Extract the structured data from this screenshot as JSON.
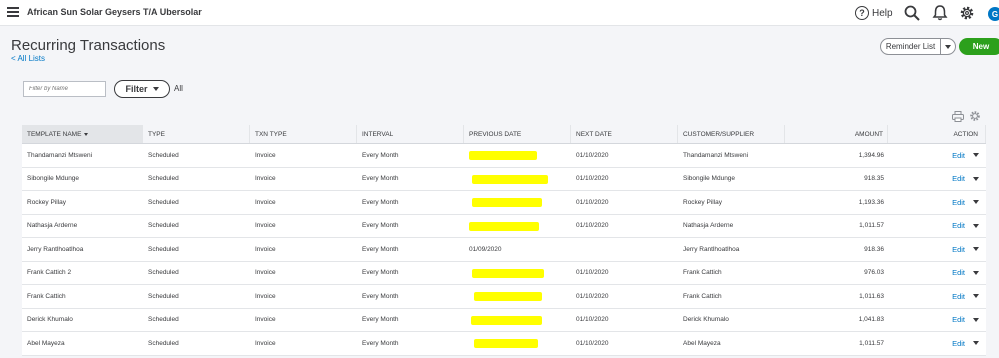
{
  "header": {
    "company": "African Sun Solar Geysers T/A Ubersolar",
    "help_label": "Help",
    "help_glyph": "?",
    "avatar_letter": "G"
  },
  "page": {
    "title": "Recurring Transactions",
    "back_link": "< All Lists"
  },
  "actions": {
    "reminder_label": "Reminder List",
    "new_label": "New"
  },
  "filters": {
    "name_placeholder": "Filter by Name",
    "filter_label": "Filter",
    "all_label": "All"
  },
  "table": {
    "columns": [
      "TEMPLATE NAME",
      "TYPE",
      "TXN TYPE",
      "INTERVAL",
      "PREVIOUS DATE",
      "NEXT DATE",
      "CUSTOMER/SUPPLIER",
      "AMOUNT",
      "ACTION"
    ],
    "rows": [
      {
        "name": "Thandamanzi Mtsweni",
        "type": "Scheduled",
        "txn_type": "Invoice",
        "interval": "Every Month",
        "previous_date": "",
        "previous_redacted": true,
        "next_date": "01/10/2020",
        "customer": "Thandamanzi Mtsweni",
        "amount": "1,394.96",
        "action": "Edit"
      },
      {
        "name": "Sibongile Mdunge",
        "type": "Scheduled",
        "txn_type": "Invoice",
        "interval": "Every Month",
        "previous_date": "",
        "previous_redacted": true,
        "next_date": "01/10/2020",
        "customer": "Sibongile Mdunge",
        "amount": "918.35",
        "action": "Edit"
      },
      {
        "name": "Rockey Pillay",
        "type": "Scheduled",
        "txn_type": "Invoice",
        "interval": "Every Month",
        "previous_date": "",
        "previous_redacted": true,
        "next_date": "01/10/2020",
        "customer": "Rockey Pillay",
        "amount": "1,193.36",
        "action": "Edit"
      },
      {
        "name": "Nathasja Arderne",
        "type": "Scheduled",
        "txn_type": "Invoice",
        "interval": "Every Month",
        "previous_date": "",
        "previous_redacted": true,
        "next_date": "01/10/2020",
        "customer": "Nathasja Arderne",
        "amount": "1,011.57",
        "action": "Edit"
      },
      {
        "name": "Jerry Rantlhoatlhoa",
        "type": "Scheduled",
        "txn_type": "Invoice",
        "interval": "Every Month",
        "previous_date": "01/09/2020",
        "previous_redacted": false,
        "next_date": "",
        "customer": "Jerry Rantlhoatlhoa",
        "amount": "918.36",
        "action": "Edit"
      },
      {
        "name": "Frank Cattich 2",
        "type": "Scheduled",
        "txn_type": "Invoice",
        "interval": "Every Month",
        "previous_date": "",
        "previous_redacted": true,
        "next_date": "01/10/2020",
        "customer": "Frank Cattich",
        "amount": "976.03",
        "action": "Edit"
      },
      {
        "name": "Frank Cattich",
        "type": "Scheduled",
        "txn_type": "Invoice",
        "interval": "Every Month",
        "previous_date": "",
        "previous_redacted": true,
        "next_date": "01/10/2020",
        "customer": "Frank Cattich",
        "amount": "1,011.63",
        "action": "Edit"
      },
      {
        "name": "Derick Khumalo",
        "type": "Scheduled",
        "txn_type": "Invoice",
        "interval": "Every Month",
        "previous_date": "",
        "previous_redacted": true,
        "next_date": "01/10/2020",
        "customer": "Derick Khumalo",
        "amount": "1,041.83",
        "action": "Edit"
      },
      {
        "name": "Abel Mayeza",
        "type": "Scheduled",
        "txn_type": "Invoice",
        "interval": "Every Month",
        "previous_date": "",
        "previous_redacted": true,
        "next_date": "01/10/2020",
        "customer": "Abel Mayeza",
        "amount": "1,011.57",
        "action": "Edit"
      }
    ]
  },
  "colors": {
    "accent": "#0077c5",
    "new_button": "#2ca01c",
    "redaction": "#ffff00"
  },
  "icons": [
    "hamburger-icon",
    "help-icon",
    "search-icon",
    "bell-icon",
    "gear-icon",
    "print-icon",
    "settings-icon",
    "sort-down-icon",
    "chevron-down-icon"
  ]
}
